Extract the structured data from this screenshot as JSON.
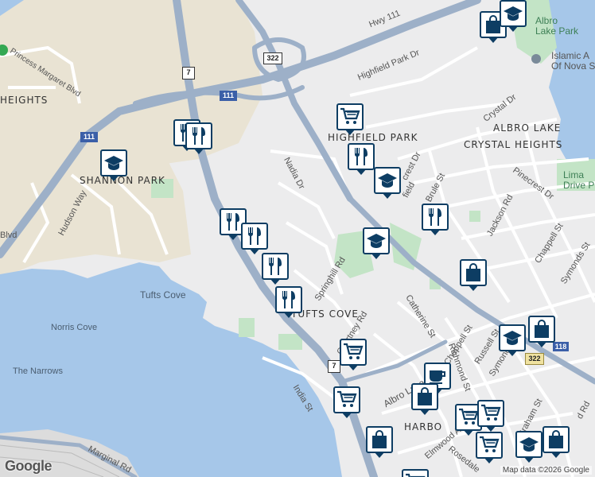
{
  "map": {
    "roads": {
      "hwy111": "Hwy 111",
      "highfield_park_dr": "Highfield Park Dr",
      "nadia_dr": "Nadia Dr",
      "springhill_rd": "Springhill Rd",
      "courtney_rd": "Courtney Rd",
      "catherine_st": "Catherine St",
      "chappell_st_1": "Chappell St",
      "chappell_st_2": "Chappell St",
      "russell_st": "Russell St",
      "symonds_st_1": "Symonds St",
      "symonds_st_2": "Symonds",
      "albro_lake_rd": "Albro Lake Rd",
      "richmond_st": "Richmond St",
      "elmwood_ave": "Elmwood Ave",
      "rosedale": "Rosedale",
      "india_st": "India St",
      "marginal_rd": "Marginal Rd",
      "hudson_way": "Hudson Way",
      "princess_margaret_blvd": "Princess Margaret Blvd",
      "blvd": "Blvd",
      "crystal_dr": "Crystal Dr",
      "pinecrest_dr": "Pinecrest Dr",
      "jackson_rd": "Jackson Rd",
      "brule_st": "Brule St",
      "crest_dr": "crest Dr",
      "field": "field",
      "graham_st": "Graham St",
      "wyse_rd": "d Rd"
    },
    "areas": {
      "heights": "HEIGHTS",
      "shannon_park": "SHANNON PARK",
      "highfield_park": "HIGHFIELD PARK",
      "albro_lake": "ALBRO LAKE",
      "crystal_heights": "CRYSTAL HEIGHTS",
      "tufts_cove_area": "TUFTS COVE",
      "harbour": "HARBO"
    },
    "water": {
      "tufts_cove": "Tufts Cove",
      "norris_cove": "Norris Cove",
      "the_narrows": "The Narrows"
    },
    "parks": {
      "albro_lake_park": "Albro\nLake Park",
      "islamic": "Islamic A\nOf Nova S",
      "lima_drive": "Lima\nDrive P"
    },
    "shields": {
      "s7_top": "7",
      "s111_top": "111",
      "s111_left": "111",
      "s322_top": "322",
      "s7_bottom": "7",
      "s322_bottom": "322",
      "s118": "118"
    },
    "attribution": "Map data ©2026 Google",
    "logo": "Google"
  },
  "markers": [
    {
      "type": "restaurant-icon"
    },
    {
      "type": "restaurant-icon"
    },
    {
      "type": "school-icon"
    },
    {
      "type": "restaurant-icon"
    },
    {
      "type": "restaurant-icon"
    },
    {
      "type": "restaurant-icon"
    },
    {
      "type": "restaurant-icon"
    },
    {
      "type": "grocery-cart-icon"
    },
    {
      "type": "restaurant-icon"
    },
    {
      "type": "school-icon"
    },
    {
      "type": "restaurant-icon"
    },
    {
      "type": "school-icon"
    },
    {
      "type": "shopping-bag-icon"
    },
    {
      "type": "shopping-bag-icon"
    },
    {
      "type": "school-icon"
    },
    {
      "type": "school-icon"
    },
    {
      "type": "shopping-bag-icon"
    },
    {
      "type": "grocery-cart-icon"
    },
    {
      "type": "cafe-icon"
    },
    {
      "type": "grocery-cart-icon"
    },
    {
      "type": "shopping-bag-icon"
    },
    {
      "type": "grocery-cart-icon"
    },
    {
      "type": "grocery-cart-icon"
    },
    {
      "type": "shopping-bag-icon"
    },
    {
      "type": "grocery-cart-icon"
    },
    {
      "type": "school-icon"
    },
    {
      "type": "shopping-bag-icon"
    },
    {
      "type": "grocery-cart-icon"
    }
  ]
}
